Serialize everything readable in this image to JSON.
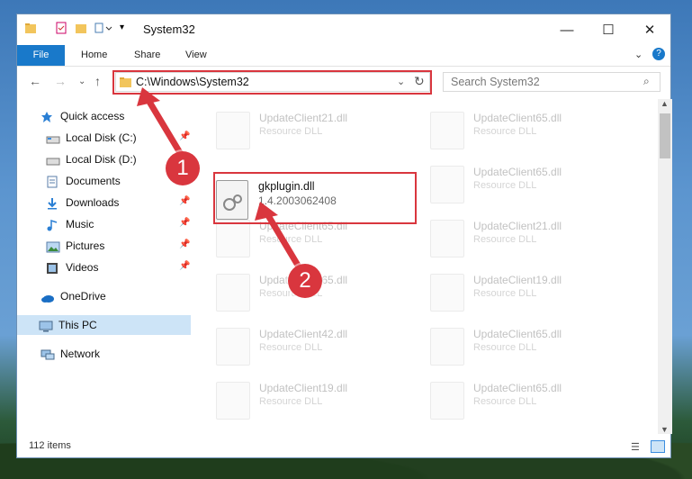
{
  "window": {
    "title": "System32"
  },
  "ribbon": {
    "tabs": [
      "File",
      "Home",
      "Share",
      "View"
    ]
  },
  "nav": {
    "address": "C:\\Windows\\System32",
    "search_placeholder": "Search System32"
  },
  "sidebar": {
    "items": [
      {
        "label": "Quick access",
        "icon": "star-icon",
        "pinned": false
      },
      {
        "label": "Local Disk (C:)",
        "icon": "drive-icon",
        "pinned": true
      },
      {
        "label": "Local Disk (D:)",
        "icon": "drive-icon",
        "pinned": false
      },
      {
        "label": "Documents",
        "icon": "documents-icon",
        "pinned": true
      },
      {
        "label": "Downloads",
        "icon": "downloads-icon",
        "pinned": true
      },
      {
        "label": "Music",
        "icon": "music-icon",
        "pinned": true
      },
      {
        "label": "Pictures",
        "icon": "pictures-icon",
        "pinned": true
      },
      {
        "label": "Videos",
        "icon": "videos-icon",
        "pinned": true
      },
      {
        "label": "OneDrive",
        "icon": "cloud-icon",
        "pinned": false
      },
      {
        "label": "This PC",
        "icon": "computer-icon",
        "pinned": false,
        "selected": true
      },
      {
        "label": "Network",
        "icon": "network-icon",
        "pinned": false
      }
    ]
  },
  "files": {
    "highlighted": {
      "name": "gkplugin.dll",
      "description": "1.4.2003062408"
    },
    "faded": [
      {
        "name": "UpdateClient21.dll",
        "description": "Resource DLL"
      },
      {
        "name": "UpdateClient65.dll",
        "description": "Resource DLL"
      },
      {
        "name": "UpdateClient65.dll",
        "description": "Resource DLL"
      },
      {
        "name": "UpdateClient65.dll",
        "description": "Resource DLL"
      },
      {
        "name": "UpdateClient21.dll",
        "description": "Resource DLL"
      },
      {
        "name": "UpdateClient65.dll",
        "description": "Resource DLL"
      },
      {
        "name": "UpdateClient19.dll",
        "description": "Resource DLL"
      },
      {
        "name": "UpdateClient42.dll",
        "description": "Resource DLL"
      },
      {
        "name": "UpdateClient65.dll",
        "description": "Resource DLL"
      },
      {
        "name": "UpdateClient19.dll",
        "description": "Resource DLL"
      },
      {
        "name": "UpdateClient65.dll",
        "description": "Resource DLL"
      }
    ]
  },
  "status": {
    "item_count": "112 items"
  },
  "annotations": {
    "marker1": "1",
    "marker2": "2"
  },
  "colors": {
    "highlight": "#d9363e",
    "accent": "#1979ca",
    "selection": "#cde4f7"
  }
}
